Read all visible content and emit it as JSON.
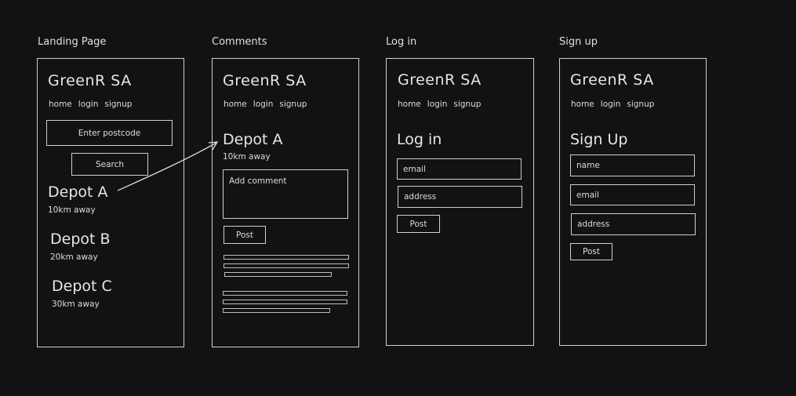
{
  "captions": {
    "landing": "Landing Page",
    "comments": "Comments",
    "login": "Log in",
    "signup": "Sign up"
  },
  "brand": "GreenR SA",
  "nav": {
    "home": "home",
    "login": "login",
    "signup": "signup"
  },
  "landing": {
    "postcode_placeholder": "Enter postcode",
    "search_label": "Search",
    "depots": [
      {
        "name": "Depot A",
        "distance": "10km away"
      },
      {
        "name": "Depot B",
        "distance": "20km away"
      },
      {
        "name": "Depot C",
        "distance": "30km away"
      }
    ]
  },
  "comments": {
    "depot_name": "Depot A",
    "distance": "10km away",
    "comment_placeholder": "Add comment",
    "post_label": "Post"
  },
  "login": {
    "title": "Log in",
    "email_placeholder": "email",
    "address_placeholder": "address",
    "post_label": "Post"
  },
  "signup": {
    "title": "Sign Up",
    "name_placeholder": "name",
    "email_placeholder": "email",
    "address_placeholder": "address",
    "post_label": "Post"
  },
  "colors": {
    "background": "#121214",
    "stroke": "#cfcfcf",
    "text": "#e6e6e6"
  }
}
